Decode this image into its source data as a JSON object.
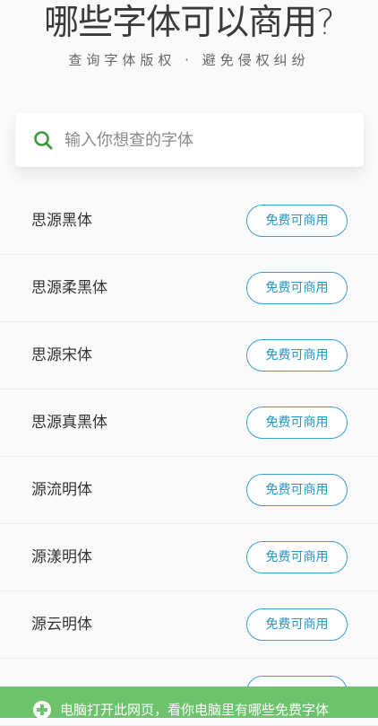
{
  "header": {
    "title": "哪些字体可以商用?",
    "subtitle": "查询字体版权 · 避免侵权纠纷"
  },
  "search": {
    "placeholder": "输入你想查的字体",
    "value": ""
  },
  "fonts": [
    {
      "name": "思源黑体",
      "license_label": "免费可商用"
    },
    {
      "name": "思源柔黑体",
      "license_label": "免费可商用"
    },
    {
      "name": "思源宋体",
      "license_label": "免费可商用"
    },
    {
      "name": "思源真黑体",
      "license_label": "免费可商用"
    },
    {
      "name": "源流明体",
      "license_label": "免费可商用"
    },
    {
      "name": "源漾明体",
      "license_label": "免费可商用"
    },
    {
      "name": "源云明体",
      "license_label": "免费可商用"
    },
    {
      "name": "",
      "license_label": ""
    }
  ],
  "banner": {
    "icon": "plus-circle-icon",
    "text": "电脑打开此网页，看你电脑里有哪些免费字体"
  },
  "colors": {
    "accent": "#2596c8",
    "search_icon": "#3c9a3c",
    "banner_bg": "#6cc36b",
    "background": "#fafafa"
  }
}
